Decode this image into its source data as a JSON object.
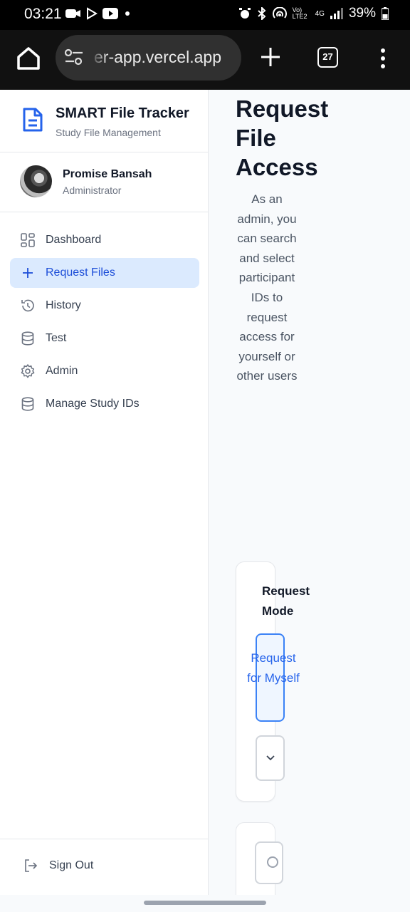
{
  "status_bar": {
    "time": "03:21",
    "battery": "39%",
    "network": "4G",
    "carrier_badge": "Vo) LTE2"
  },
  "browser": {
    "url": "er-app.vercel.app",
    "tab_count": "27"
  },
  "sidebar": {
    "brand_title": "SMART File Tracker",
    "brand_subtitle": "Study File Management",
    "user_name": "Promise Bansah",
    "user_role": "Administrator",
    "items": [
      {
        "label": "Dashboard",
        "icon": "dashboard-icon",
        "active": false
      },
      {
        "label": "Request Files",
        "icon": "plus-icon",
        "active": true
      },
      {
        "label": "History",
        "icon": "history-icon",
        "active": false
      },
      {
        "label": "Test",
        "icon": "database-icon",
        "active": false
      },
      {
        "label": "Admin",
        "icon": "gear-icon",
        "active": false
      },
      {
        "label": "Manage Study IDs",
        "icon": "database-icon",
        "active": false
      }
    ],
    "sign_out": "Sign Out"
  },
  "main": {
    "title": "Request File Access",
    "description": "As an admin, you can search and select participant IDs to request access for yourself or other users",
    "request_mode_label": "Request Mode",
    "mode_button": "Request for Myself"
  },
  "colors": {
    "accent": "#2563eb",
    "active_bg": "#dbeafe",
    "page_bg": "#f8fafc"
  }
}
